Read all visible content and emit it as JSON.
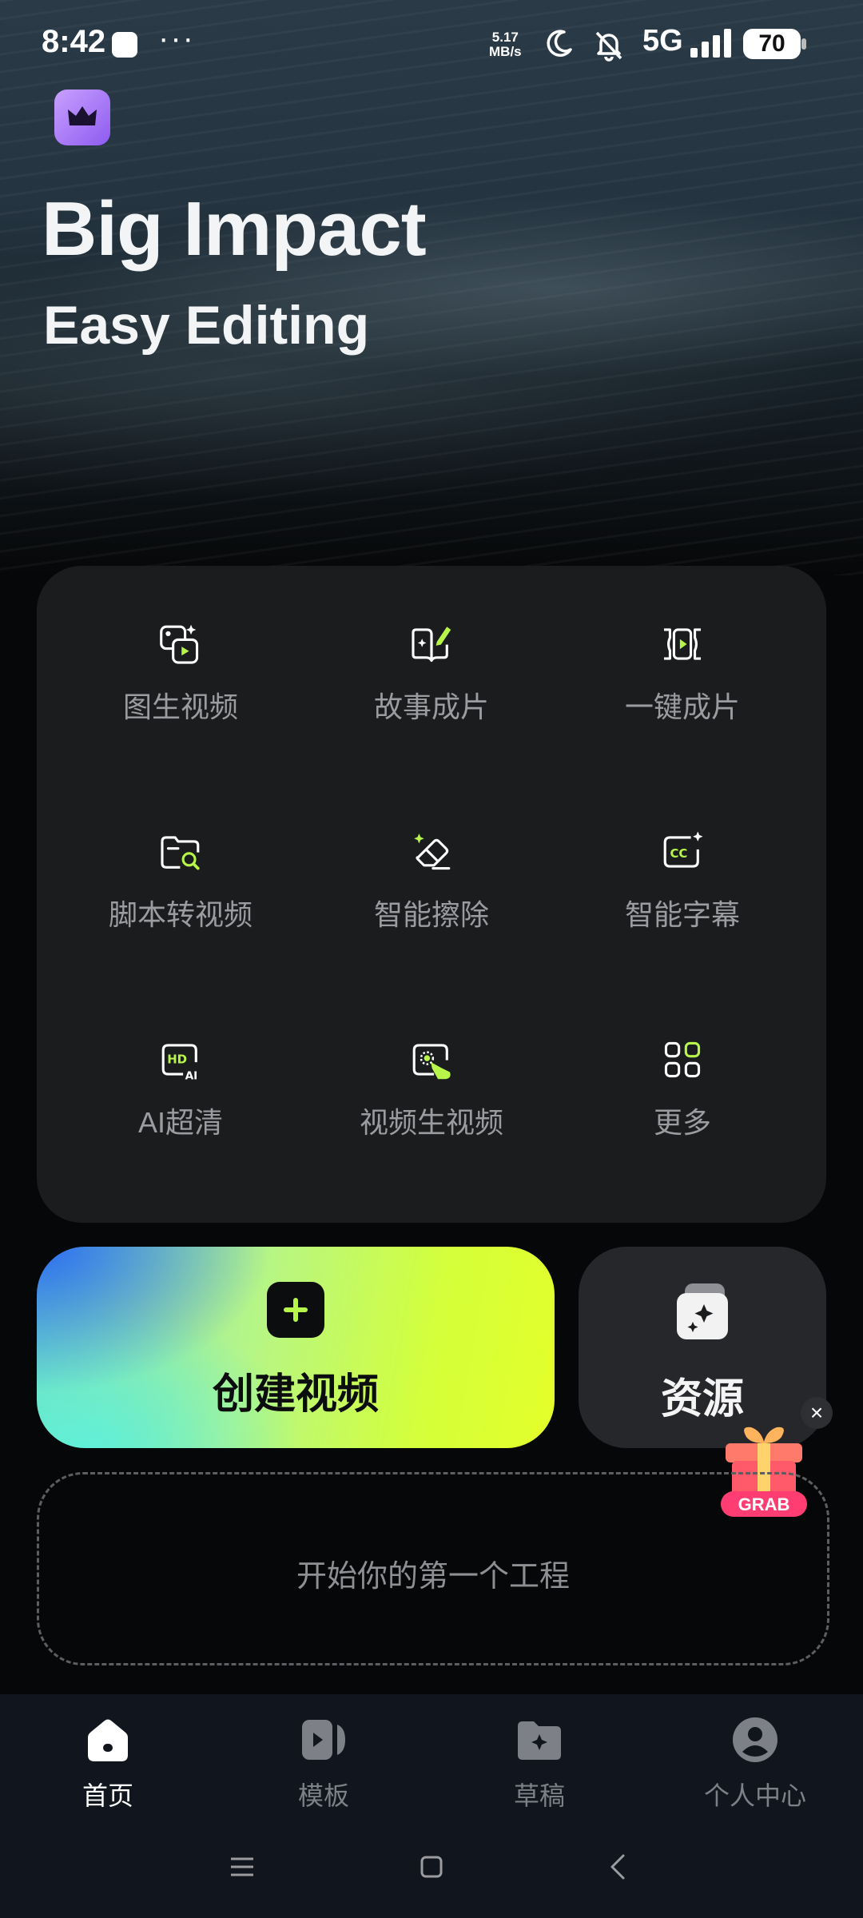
{
  "status_bar": {
    "time": "8:42",
    "dots": "···",
    "speed_value": "5.17",
    "speed_unit": "MB/s",
    "network": "5G",
    "battery": "70"
  },
  "hero": {
    "title": "Big Impact",
    "subtitle": "Easy Editing",
    "badge_icon": "crown-icon"
  },
  "tools": [
    {
      "label": "图生视频",
      "icon": "image-to-video-icon"
    },
    {
      "label": "故事成片",
      "icon": "story-book-icon"
    },
    {
      "label": "一键成片",
      "icon": "one-click-film-icon"
    },
    {
      "label": "脚本转视频",
      "icon": "script-folder-icon"
    },
    {
      "label": "智能擦除",
      "icon": "eraser-icon"
    },
    {
      "label": "智能字幕",
      "icon": "cc-subtitle-icon"
    },
    {
      "label": "AI超清",
      "icon": "hd-ai-icon"
    },
    {
      "label": "视频生视频",
      "icon": "video-to-video-icon"
    },
    {
      "label": "更多",
      "icon": "more-grid-icon"
    }
  ],
  "create_button": {
    "label": "创建视频"
  },
  "resources_button": {
    "label": "资源"
  },
  "promo": {
    "label": "GRAB",
    "close": "×"
  },
  "project": {
    "placeholder": "开始你的第一个工程"
  },
  "bottom_nav": [
    {
      "label": "首页",
      "icon": "home-icon",
      "active": true
    },
    {
      "label": "模板",
      "icon": "template-icon",
      "active": false
    },
    {
      "label": "草稿",
      "icon": "draft-folder-icon",
      "active": false
    },
    {
      "label": "个人中心",
      "icon": "profile-icon",
      "active": false
    }
  ],
  "colors": {
    "accent_green": "#b8f54a",
    "panel_bg": "#1b1c1e",
    "nav_bg": "#11151d"
  }
}
